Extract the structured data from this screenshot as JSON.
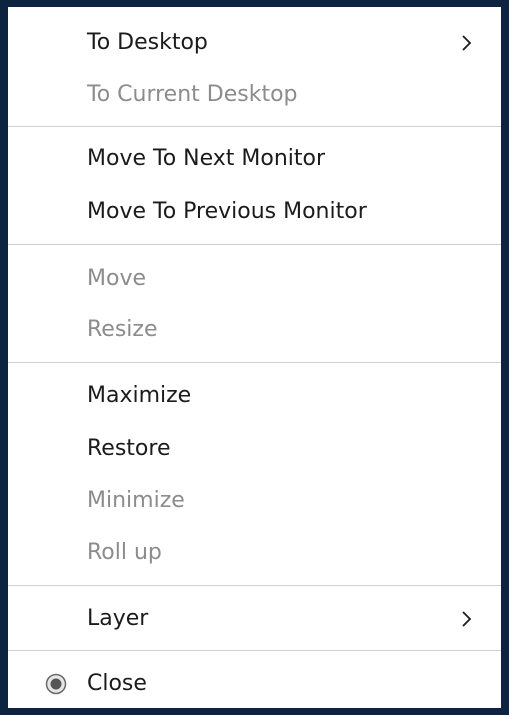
{
  "menu": {
    "items": [
      {
        "label": "To Desktop",
        "enabled": true,
        "submenu": true
      },
      {
        "label": "To Current Desktop",
        "enabled": false
      },
      {
        "label": "Move To Next Monitor",
        "enabled": true
      },
      {
        "label": "Move To Previous Monitor",
        "enabled": true
      },
      {
        "label": "Move",
        "enabled": false
      },
      {
        "label": "Resize",
        "enabled": false
      },
      {
        "label": "Maximize",
        "enabled": true
      },
      {
        "label": "Restore",
        "enabled": true
      },
      {
        "label": "Minimize",
        "enabled": false
      },
      {
        "label": "Roll up",
        "enabled": false
      },
      {
        "label": "Layer",
        "enabled": true,
        "submenu": true
      },
      {
        "label": "Close",
        "enabled": true,
        "icon": "radio-icon"
      }
    ]
  },
  "colors": {
    "background": "#0d2340",
    "menu_bg": "#ffffff",
    "text_enabled": "#1b1b1b",
    "text_disabled": "#8c8c8c",
    "separator": "#cfcfcf"
  }
}
